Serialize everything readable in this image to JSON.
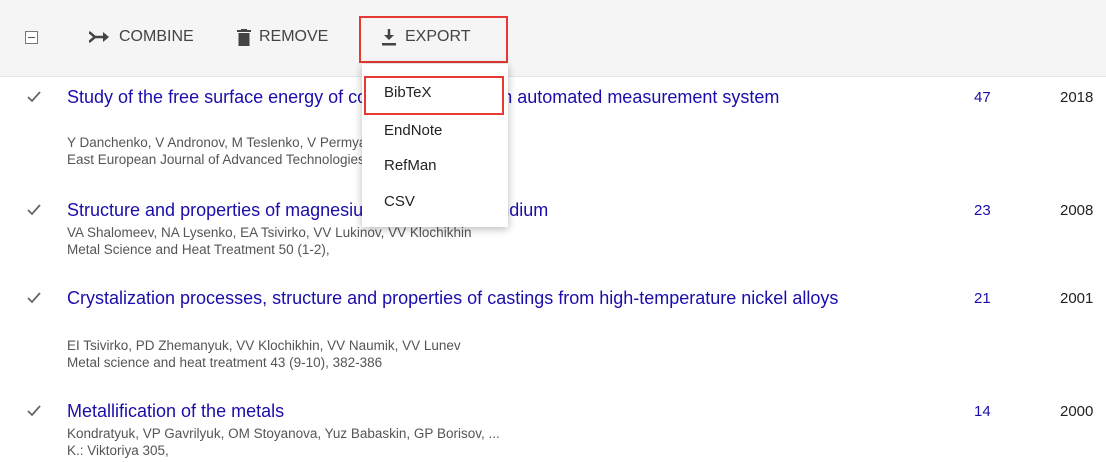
{
  "toolbar": {
    "combine_label": "COMBINE",
    "remove_label": "REMOVE",
    "export_label": "EXPORT"
  },
  "export_menu": {
    "items": [
      "BibTeX",
      "EndNote",
      "RefMan",
      "CSV"
    ],
    "highlighted": "BibTeX"
  },
  "results": [
    {
      "title": "Study of the free surface energy of composites using an automated measurement system",
      "authors": "Y Danchenko, V Andronov, M Teslenko, V Permyakov, E Rybka, ...",
      "venue": "East European Journal of Advanced Technologies",
      "cited_by": "47",
      "year": "2018",
      "checked": true
    },
    {
      "title": "Structure and properties of magnesium alloys with scandium",
      "authors": "VA Shalomeev, NA Lysenko, EA Tsivirko, VV Lukinov, VV Klochikhin",
      "venue": "Metal Science and Heat Treatment 50 (1-2),",
      "cited_by": "23",
      "year": "2008",
      "checked": true
    },
    {
      "title": "Crystalization processes, structure and properties of castings from high-temperature nickel alloys",
      "authors": "EI Tsivirko, PD Zhemanyuk, VV Klochikhin, VV Naumik, VV Lunev",
      "venue": "Metal science and heat treatment 43 (9-10), 382-386",
      "cited_by": "21",
      "year": "2001",
      "checked": true
    },
    {
      "title": "Metallification of the metals",
      "authors": "Kondratyuk, VP Gavrilyuk, OM Stoyanova, Yuz Babaskin, GP Borisov, ...",
      "venue": "K.: Viktoriya 305,",
      "cited_by": "14",
      "year": "2000",
      "checked": true
    }
  ],
  "colors": {
    "link": "#1a0dab",
    "highlight_border": "#e53935",
    "toolbar_bg": "#f5f5f5"
  }
}
